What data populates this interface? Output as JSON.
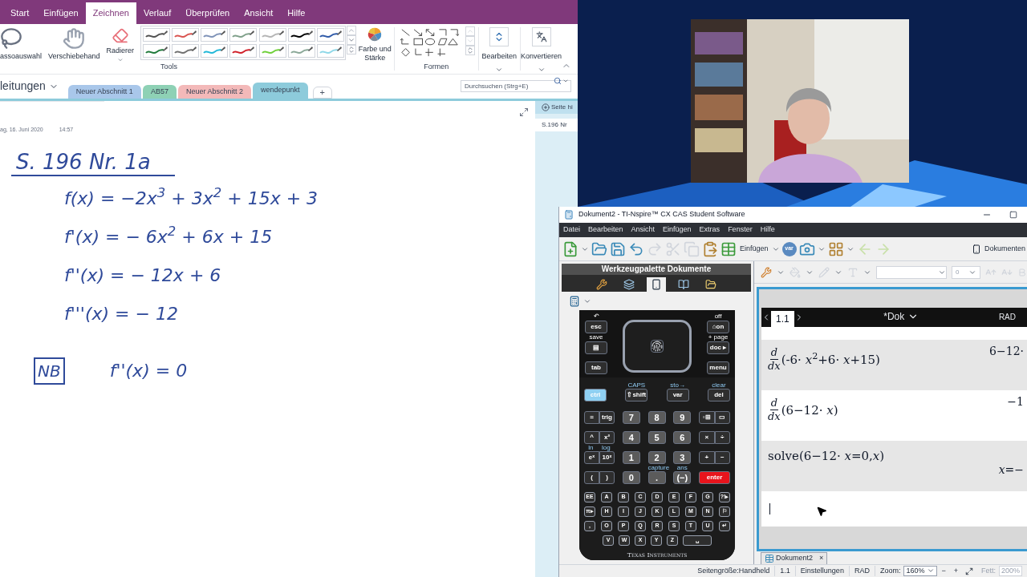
{
  "onenote": {
    "ribbon_tabs": [
      {
        "label": "Start",
        "selected": false
      },
      {
        "label": "Einfügen",
        "selected": false
      },
      {
        "label": "Zeichnen",
        "selected": true
      },
      {
        "label": "Verlauf",
        "selected": false
      },
      {
        "label": "Überprüfen",
        "selected": false
      },
      {
        "label": "Ansicht",
        "selected": false
      },
      {
        "label": "Hilfe",
        "selected": false
      }
    ],
    "tools": [
      {
        "kind": "lasso",
        "label": "assoauswahl"
      },
      {
        "kind": "hand",
        "label": "Verschiebehand"
      },
      {
        "kind": "eraser",
        "label": "Radierer"
      }
    ],
    "pens": [
      {
        "color": "#505050"
      },
      {
        "color": "#d9534f"
      },
      {
        "color": "#7f93b8"
      },
      {
        "color": "#7fa08a"
      },
      {
        "color": "#b5b5b5"
      },
      {
        "color": "#000000"
      },
      {
        "color": "#2f5aa8"
      },
      {
        "color": "#1f7a3a"
      },
      {
        "color": "#707070"
      },
      {
        "color": "#22b8d8"
      },
      {
        "color": "#d0202a"
      },
      {
        "color": "#6fd03a"
      },
      {
        "color": "#8aa898"
      },
      {
        "color": "#8fd8e8"
      }
    ],
    "color_button": "Farbe und Stärke",
    "tools_group": "Tools",
    "shapes_group": "Formen",
    "edit_buttons": [
      {
        "kind": "edit",
        "label": "Bearbeiten"
      },
      {
        "kind": "convert",
        "label": "Konvertieren"
      }
    ],
    "notebook": "leitungen",
    "sections": [
      {
        "label": "Neuer Abschnitt 1",
        "color": "#a9c7ea",
        "selected": false
      },
      {
        "label": "AB57",
        "color": "#8ed1b5",
        "selected": false
      },
      {
        "label": "Neuer Abschnitt 2",
        "color": "#f3b9b9",
        "selected": false
      },
      {
        "label": "wendepunkt",
        "color": "#8dcbdb",
        "selected": true
      }
    ],
    "add_section": "+",
    "search": {
      "placeholder": "Durchsuchen (Strg+E)"
    },
    "page": {
      "date": "ag, 16. Juni 2020",
      "time": "14:57",
      "title": "S. 196  Nr. 1a",
      "lines": [
        "f(x) = −2x$^{3}$ + 3x$^{2}$ + 15x + 3",
        "f'(x) = − 6x$^{2}$ + 6x + 15",
        "f''(x) = − 12x  + 6",
        "f'''(x) = − 12"
      ],
      "box_label": "NB",
      "condition": "f''(x) = 0"
    },
    "page_pane": {
      "add": "Seite hi",
      "pages": [
        {
          "label": "S.196 Nr",
          "selected": true
        }
      ]
    }
  },
  "nspire": {
    "title": "Dokument2 - TI-Nspire™ CX CAS Student Software",
    "menu": [
      "Datei",
      "Bearbeiten",
      "Ansicht",
      "Einfügen",
      "Extras",
      "Fenster",
      "Hilfe"
    ],
    "insert_button": "Einfügen",
    "var_button": "var",
    "documents_button": "Dokumenten",
    "palette_title": "Werkzeugpalette Dokumente",
    "palette_tabs": [
      {
        "kind": "tools",
        "selected": false
      },
      {
        "kind": "pages",
        "selected": false
      },
      {
        "kind": "handheld",
        "selected": true
      },
      {
        "kind": "book",
        "selected": false
      },
      {
        "kind": "folder",
        "selected": false
      }
    ],
    "font_size": "0",
    "keypad": {
      "top_left": [
        {
          "label": "esc",
          "legend": "↶"
        },
        {
          "label": "▤",
          "legend": "save"
        },
        {
          "label": "tab"
        }
      ],
      "top_right": [
        {
          "label": "⌂on",
          "legend": "off"
        },
        {
          "label": "doc ▸",
          "legend": "+ page"
        },
        {
          "label": "menu"
        }
      ],
      "row_ctrl": [
        {
          "kind": "ctrl",
          "label": "ctrl"
        },
        {
          "kind": "func",
          "label": "⇧shift",
          "legend": "CAPS"
        },
        {
          "kind": "func",
          "label": "var",
          "legend": "sto→"
        },
        {
          "kind": "func",
          "label": "del",
          "legend": "clear"
        }
      ],
      "grid": [
        [
          {
            "kind": "pair",
            "labels": [
              "=",
              "trig"
            ]
          },
          {
            "kind": "digit",
            "labels": [
              "7"
            ]
          },
          {
            "kind": "digit",
            "labels": [
              "8"
            ]
          },
          {
            "kind": "digit",
            "labels": [
              "9"
            ]
          },
          {
            "kind": "pair",
            "labels": [
              "▫⊞",
              "▭"
            ]
          }
        ],
        [
          {
            "kind": "pair",
            "labels": [
              "^",
              "x²"
            ]
          },
          {
            "kind": "digit",
            "labels": [
              "4"
            ]
          },
          {
            "kind": "digit",
            "labels": [
              "5"
            ]
          },
          {
            "kind": "digit",
            "labels": [
              "6"
            ]
          },
          {
            "kind": "pair",
            "labels": [
              "×",
              "÷"
            ]
          }
        ],
        [
          {
            "kind": "pair",
            "labels": [
              "eˣ",
              "10ˣ"
            ],
            "legends": [
              "ln",
              "log"
            ]
          },
          {
            "kind": "digit",
            "labels": [
              "1"
            ]
          },
          {
            "kind": "digit",
            "labels": [
              "2"
            ]
          },
          {
            "kind": "digit",
            "labels": [
              "3"
            ]
          },
          {
            "kind": "pair",
            "labels": [
              "+",
              "−"
            ]
          }
        ],
        [
          {
            "kind": "pair",
            "labels": [
              "(",
              ")"
            ]
          },
          {
            "kind": "digit",
            "labels": [
              "0"
            ]
          },
          {
            "kind": "digit",
            "labels": [
              "."
            ],
            "legends": [
              "capture"
            ]
          },
          {
            "kind": "digit",
            "labels": [
              "(−)"
            ],
            "legends": [
              "ans"
            ]
          },
          {
            "kind": "enter",
            "labels": [
              "enter"
            ]
          }
        ]
      ],
      "letters": [
        [
          "EE",
          "A",
          "B",
          "C",
          "D",
          "E",
          "F",
          "G",
          "?!▸"
        ],
        [
          "π▸",
          "H",
          "I",
          "J",
          "K",
          "L",
          "M",
          "N",
          "⚐"
        ],
        [
          ",",
          "O",
          "P",
          "Q",
          "R",
          "S",
          "T",
          "U",
          "↵"
        ],
        [
          "V",
          "W",
          "X",
          "Y",
          "Z",
          "␣"
        ]
      ],
      "brand": "Texas Instruments"
    },
    "page_tab": "1.1",
    "doc_name": "*Dok",
    "mode": "RAD",
    "entries": [
      {
        "kind": "derivative",
        "numerator": "d",
        "denominator": "dx",
        "expression": "(-6· *x*$^{2}$+6· *x*+15)",
        "result": "6−12·"
      },
      {
        "kind": "derivative",
        "numerator": "d",
        "denominator": "dx",
        "expression": "(6−12· *x*)",
        "result": "−1"
      },
      {
        "kind": "plain",
        "expression": "solve(6−12· *x*=0,*x*)",
        "result": "*x*=−"
      }
    ],
    "doc_tab": {
      "label": "Dokument2",
      "close": "×"
    },
    "status": [
      "Seitengröße:Handheld",
      "1.1",
      "Einstellungen",
      "RAD"
    ],
    "zoom": {
      "label": "Zoom:",
      "value": "160%",
      "minus": "−",
      "plus": "+"
    },
    "bold": {
      "label": "Fett:",
      "value": "200%"
    }
  }
}
